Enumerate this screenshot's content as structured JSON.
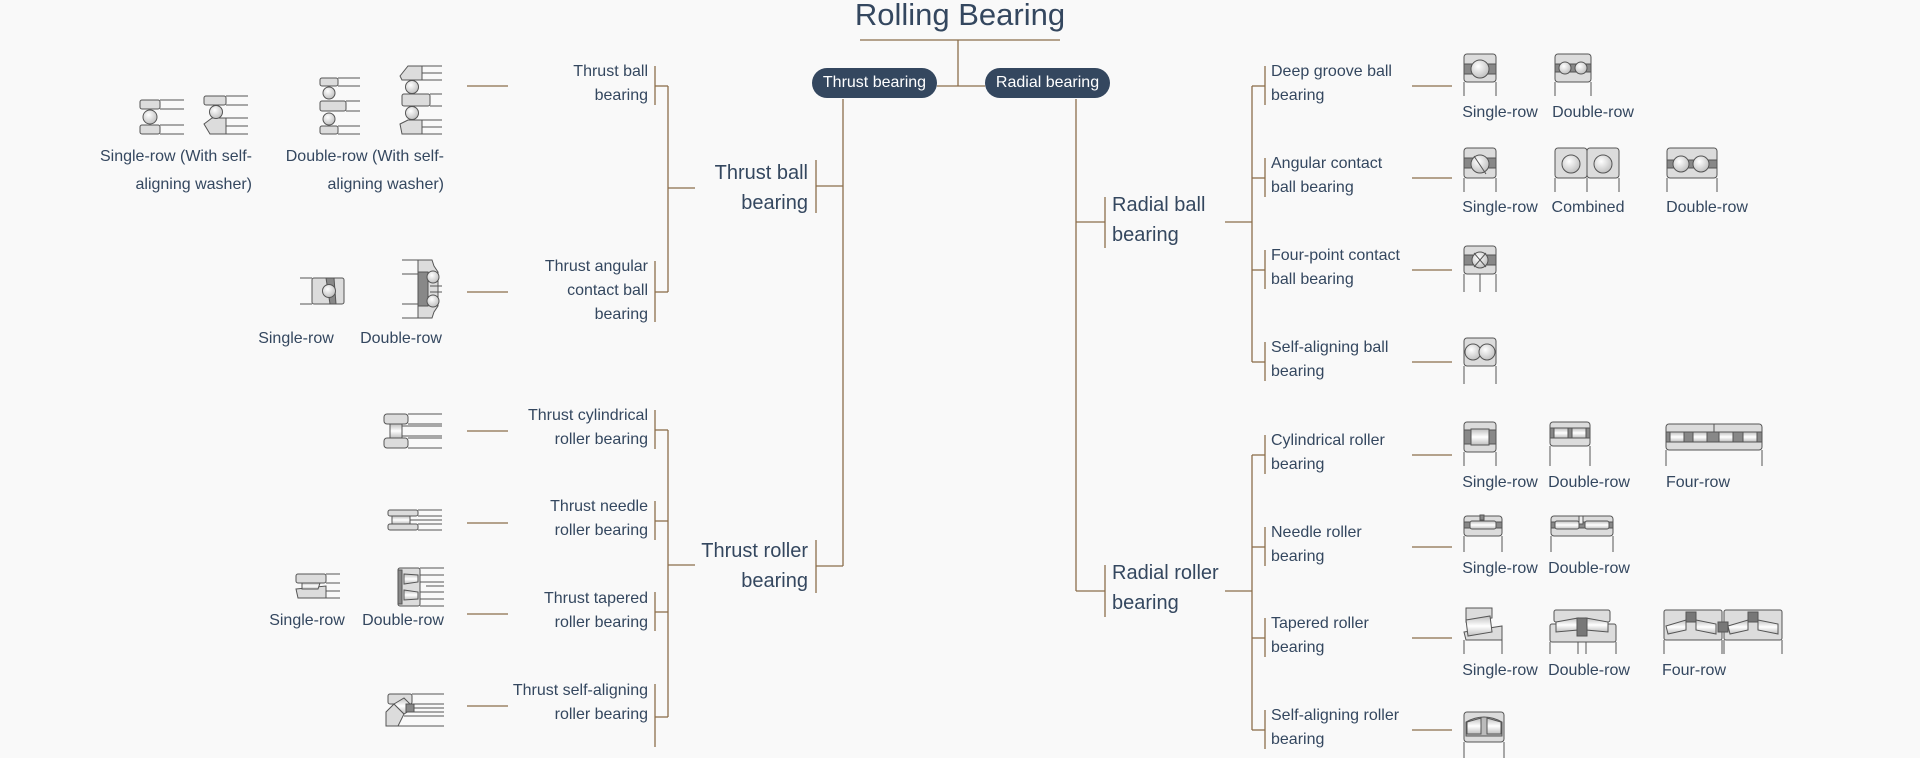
{
  "title": "Rolling Bearing",
  "colors": {
    "node_bg": "#34475f",
    "text": "#34475f",
    "line": "#8c6e4b",
    "background": "#f9f9f9"
  },
  "roots": {
    "thrust": "Thrust bearing",
    "radial": "Radial bearing"
  },
  "thrust": {
    "ball": {
      "label": "Thrust ball bearing",
      "children": [
        {
          "label": "Thrust ball bearing",
          "variants": [
            "Single-row (With self-aligning washer)",
            "Double-row (With self-aligning washer)"
          ]
        },
        {
          "label": "Thrust angular contact ball bearing",
          "variants": [
            "Single-row",
            "Double-row"
          ]
        }
      ]
    },
    "roller": {
      "label": "Thrust roller bearing",
      "children": [
        {
          "label": "Thrust cylindrical roller bearing",
          "variants": []
        },
        {
          "label": "Thrust needle roller bearing",
          "variants": []
        },
        {
          "label": "Thrust tapered roller bearing",
          "variants": [
            "Single-row",
            "Double-row"
          ]
        },
        {
          "label": "Thrust self-aligning roller bearing",
          "variants": []
        }
      ]
    }
  },
  "radial": {
    "ball": {
      "label": "Radial ball bearing",
      "children": [
        {
          "label": "Deep groove ball bearing",
          "variants": [
            "Single-row",
            "Double-row"
          ]
        },
        {
          "label": "Angular contact ball bearing",
          "variants": [
            "Single-row",
            "Combined",
            "Double-row"
          ]
        },
        {
          "label": "Four-point contact ball bearing",
          "variants": []
        },
        {
          "label": "Self-aligning ball bearing",
          "variants": []
        }
      ]
    },
    "roller": {
      "label": "Radial roller bearing",
      "children": [
        {
          "label": "Cylindrical roller bearing",
          "variants": [
            "Single-row",
            "Double-row",
            "Four-row"
          ]
        },
        {
          "label": "Needle roller bearing",
          "variants": [
            "Single-row",
            "Double-row"
          ]
        },
        {
          "label": "Tapered roller bearing",
          "variants": [
            "Single-row",
            "Double-row",
            "Four-row"
          ]
        },
        {
          "label": "Self-aligning roller bearing",
          "variants": []
        }
      ]
    }
  }
}
